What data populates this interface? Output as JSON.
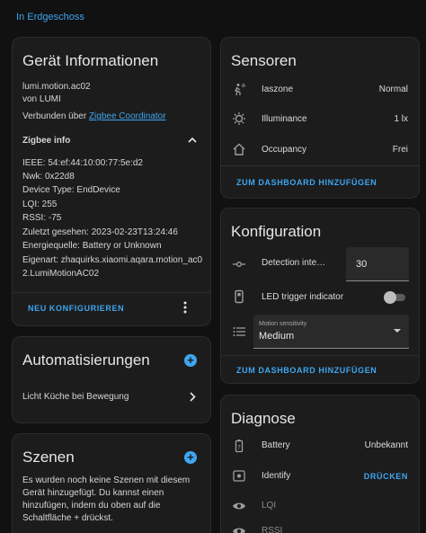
{
  "breadcrumb": "In Erdgeschoss",
  "device": {
    "title": "Gerät Informationen",
    "model": "lumi.motion.ac02",
    "manufacturer": "von LUMI",
    "connected_prefix": "Verbunden über",
    "connected_link": "Zigbee Coordinator",
    "zigbee_info_label": "Zigbee info",
    "ieee": "IEEE: 54:ef:44:10:00:77:5e:d2",
    "nwk": "Nwk: 0x22d8",
    "device_type": "Device Type: EndDevice",
    "lqi": "LQI: 255",
    "rssi": "RSSI: -75",
    "last_seen": "Zuletzt gesehen: 2023-02-23T13:24:46",
    "power_source": "Energiequelle: Battery or Unknown",
    "quirk_line1": "Eigenart: zhaquirks.xiaomi.aqara.motion_ac0",
    "quirk_line2": "2.LumiMotionAC02",
    "reconfigure_label": "NEU KONFIGURIEREN"
  },
  "automations": {
    "title": "Automatisierungen",
    "items": [
      {
        "label": "Licht Küche bei Bewegung"
      }
    ]
  },
  "scenes": {
    "title": "Szenen",
    "text_lines": [
      "Es wurden noch keine Szenen mit diesem",
      "Gerät hinzugefügt. Du kannst einen",
      "hinzufügen, indem du oben auf die",
      "Schaltfläche + drückst."
    ]
  },
  "sensors": {
    "title": "Sensoren",
    "rows": [
      {
        "icon": "motion-sensor-icon",
        "label": "Iaszone",
        "value": "Normal"
      },
      {
        "icon": "brightness-icon",
        "label": "Illuminance",
        "value": "1 lx"
      },
      {
        "icon": "home-icon",
        "label": "Occupancy",
        "value": "Frei"
      }
    ],
    "dashboard_label": "ZUM DASHBOARD HINZUFÜGEN"
  },
  "config": {
    "title": "Konfiguration",
    "detection_label": "Detection inte…",
    "detection_value": "30",
    "led_label": "LED trigger indicator",
    "led_on": false,
    "sensitivity_label": "Motion sensitivity",
    "sensitivity_value": "Medium",
    "dashboard_label": "ZUM DASHBOARD HINZUFÜGEN"
  },
  "diagnose": {
    "title": "Diagnose",
    "battery_label": "Battery",
    "battery_value": "Unbekannt",
    "identify_label": "Identify",
    "identify_action": "DRÜCKEN",
    "lqi_label": "LQI",
    "rssi_label": "RSSI"
  },
  "colors": {
    "accent": "#3ea6f0",
    "background": "#111111",
    "card": "#1c1c1c"
  }
}
